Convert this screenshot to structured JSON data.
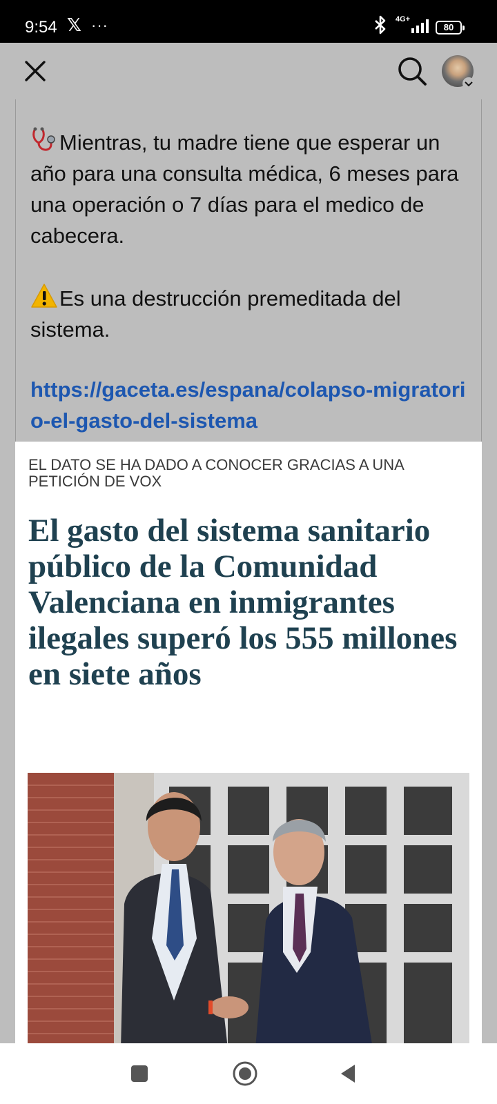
{
  "status_bar": {
    "time": "9:54",
    "x_app": "𝕏",
    "dots": "···",
    "network": "4G+",
    "battery": "80"
  },
  "app_bar": {
    "close_icon": "close-icon",
    "search_icon": "search-icon",
    "avatar": "avatar"
  },
  "post": {
    "line1_emoji": "stethoscope-icon",
    "paragraph1": "Mientras, tu madre tiene que esperar un año para una consulta médica, 6 meses para una operación o 7 días para el medico de cabecera.",
    "line2_emoji": "warning-icon",
    "paragraph2": "Es una destrucción premeditada del sistema.",
    "link": "https://gaceta.es/espana/colapso-migratorio-el-gasto-del-sistema"
  },
  "article": {
    "kicker": "EL DATO SE HA DADO A CONOCER GRACIAS A UNA PETICIÓN DE VOX",
    "headline": "El gasto del sistema sanitario público de la Comunidad Valenciana en inmigrantes ilegales superó los 555 millones en siete años"
  },
  "colors": {
    "link": "#1d57b0",
    "headline": "#1f4150",
    "dim_background": "#bdbdbd"
  }
}
